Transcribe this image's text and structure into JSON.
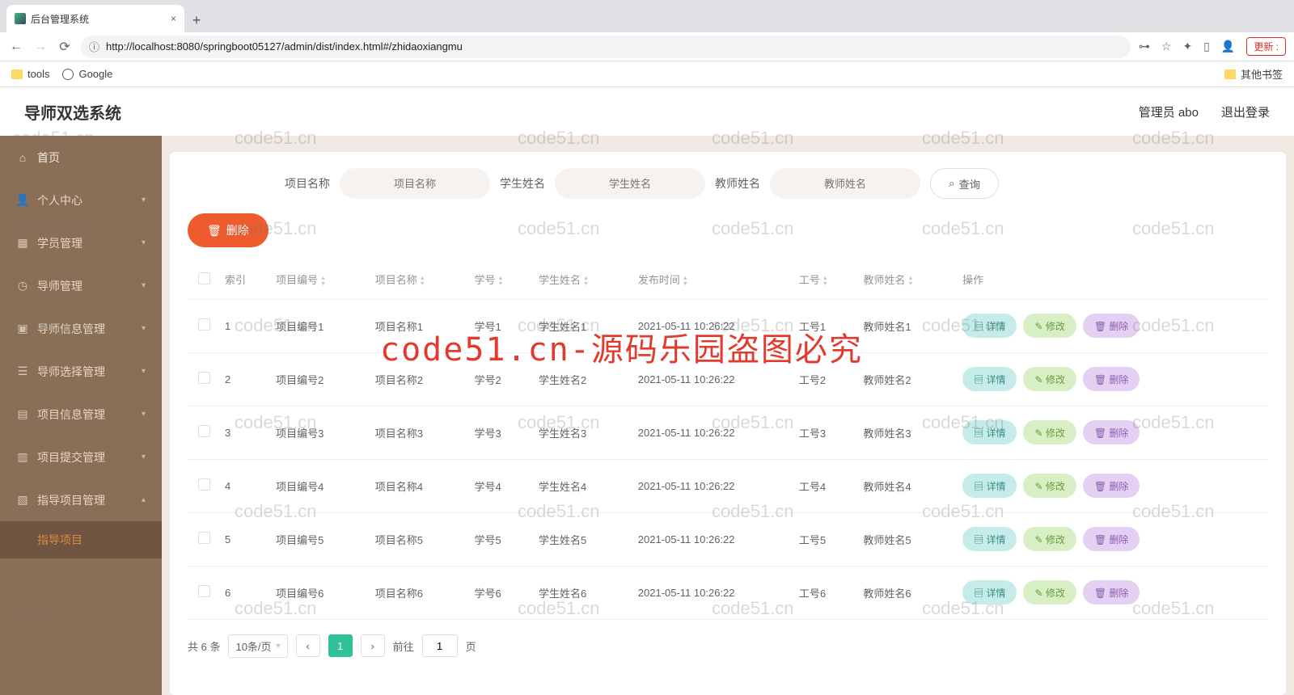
{
  "browser": {
    "tabTitle": "后台管理系统",
    "url": "http://localhost:8080/springboot05127/admin/dist/index.html#/zhidaoxiangmu",
    "bookmarks": {
      "tools": "tools",
      "google": "Google",
      "other": "其他书签"
    },
    "update": "更新 :"
  },
  "header": {
    "title": "导师双选系统",
    "user": "管理员 abo",
    "logout": "退出登录"
  },
  "sidebar": {
    "items": [
      "首页",
      "个人中心",
      "学员管理",
      "导师管理",
      "导师信息管理",
      "导师选择管理",
      "项目信息管理",
      "项目提交管理",
      "指导项目管理"
    ],
    "activeSub": "指导项目"
  },
  "search": {
    "labels": [
      "项目名称",
      "学生姓名",
      "教师姓名"
    ],
    "placeholders": [
      "项目名称",
      "学生姓名",
      "教师姓名"
    ],
    "btn": "查询"
  },
  "toolbar": {
    "delete": "删除"
  },
  "table": {
    "headers": [
      "索引",
      "项目编号",
      "项目名称",
      "学号",
      "学生姓名",
      "发布时间",
      "工号",
      "教师姓名",
      "操作"
    ],
    "opLabels": {
      "detail": "详情",
      "edit": "修改",
      "del": "删除"
    },
    "rows": [
      {
        "idx": "1",
        "pno": "项目编号1",
        "pname": "项目名称1",
        "sno": "学号1",
        "sname": "学生姓名1",
        "time": "2021-05-11 10:26:22",
        "tno": "工号1",
        "tname": "教师姓名1"
      },
      {
        "idx": "2",
        "pno": "项目编号2",
        "pname": "项目名称2",
        "sno": "学号2",
        "sname": "学生姓名2",
        "time": "2021-05-11 10:26:22",
        "tno": "工号2",
        "tname": "教师姓名2"
      },
      {
        "idx": "3",
        "pno": "项目编号3",
        "pname": "项目名称3",
        "sno": "学号3",
        "sname": "学生姓名3",
        "time": "2021-05-11 10:26:22",
        "tno": "工号3",
        "tname": "教师姓名3"
      },
      {
        "idx": "4",
        "pno": "项目编号4",
        "pname": "项目名称4",
        "sno": "学号4",
        "sname": "学生姓名4",
        "time": "2021-05-11 10:26:22",
        "tno": "工号4",
        "tname": "教师姓名4"
      },
      {
        "idx": "5",
        "pno": "项目编号5",
        "pname": "项目名称5",
        "sno": "学号5",
        "sname": "学生姓名5",
        "time": "2021-05-11 10:26:22",
        "tno": "工号5",
        "tname": "教师姓名5"
      },
      {
        "idx": "6",
        "pno": "项目编号6",
        "pname": "项目名称6",
        "sno": "学号6",
        "sname": "学生姓名6",
        "time": "2021-05-11 10:26:22",
        "tno": "工号6",
        "tname": "教师姓名6"
      }
    ]
  },
  "pager": {
    "total": "共 6 条",
    "size": "10条/页",
    "current": "1",
    "gotoLabel": "前往",
    "gotoValue": "1",
    "pageSuffix": "页"
  },
  "watermark": {
    "text": "code51.cn",
    "big": "code51.cn-源码乐园盗图必究"
  }
}
